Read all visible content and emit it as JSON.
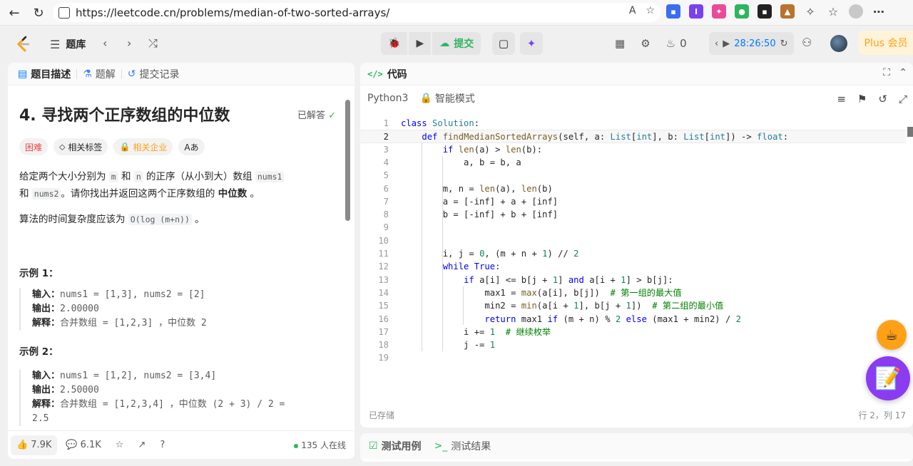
{
  "browser": {
    "url": "https://leetcode.cn/problems/median-of-two-sorted-arrays/",
    "back": "←",
    "reload": "↻"
  },
  "topbar": {
    "problem_bank": "题库",
    "submit": "提交",
    "streak": "0",
    "timer": "28:26:50",
    "plus": "Plus 会员"
  },
  "left": {
    "tabs": [
      "题目描述",
      "题解",
      "提交记录"
    ],
    "title": "4. 寻找两个正序数组的中位数",
    "solved": "已解答",
    "chips": [
      "困难",
      "相关标签",
      "相关企业",
      "Aあ"
    ],
    "desc1_a": "给定两个大小分别为 ",
    "m": "m",
    "desc1_b": " 和 ",
    "n": "n",
    "desc1_c": " 的正序（从小到大）数组 ",
    "nums1": "nums1",
    "desc2_a": "和 ",
    "nums2": "nums2",
    "desc2_b": "。请你找出并返回这两个正序数组的 ",
    "median": "中位数",
    "desc2_c": " 。",
    "complexity_a": "算法的时间复杂度应该为 ",
    "complexity_code": "O(log (m+n))",
    "complexity_b": " 。",
    "ex1_title": "示例 1：",
    "ex1": {
      "in_label": "输入：",
      "in": "nums1 = [1,3], nums2 = [2]",
      "out_label": "输出：",
      "out": "2.00000",
      "exp_label": "解释：",
      "exp": "合并数组 = [1,2,3] ，中位数 2"
    },
    "ex2_title": "示例 2：",
    "ex2": {
      "in_label": "输入：",
      "in": "nums1 = [1,2], nums2 = [3,4]",
      "out_label": "输出：",
      "out": "2.50000",
      "exp_label": "解释：",
      "exp": "合并数组 = [1,2,3,4] ，中位数 (2 + 3) / 2 =",
      "exp2": "2.5"
    },
    "likes": "7.9K",
    "comments": "6.1K",
    "online": "135 人在线"
  },
  "editor": {
    "header": "代码",
    "language": "Python3",
    "mode": "智能模式",
    "saved": "已存储",
    "cursor": "行 2，列 17",
    "lines": [
      "class Solution:",
      "    def findMedianSortedArrays(self, a: List[int], b: List[int]) -> float:",
      "        if len(a) > len(b):",
      "            a, b = b, a",
      "",
      "        m, n = len(a), len(b)",
      "        a = [-inf] + a + [inf]",
      "        b = [-inf] + b + [inf]",
      "",
      "",
      "        i, j = 0, (m + n + 1) // 2",
      "        while True:",
      "            if a[i] <= b[j + 1] and a[i + 1] > b[j]:",
      "                max1 = max(a[i], b[j])  # 第一组的最大值",
      "                min2 = min(a[i + 1], b[j + 1])  # 第二组的最小值",
      "                return max1 if (m + n) % 2 else (max1 + min2) / 2",
      "            i += 1  # 继续枚举",
      "            j -= 1",
      ""
    ]
  },
  "bottom": {
    "tab1": "测试用例",
    "tab2": "测试结果"
  }
}
